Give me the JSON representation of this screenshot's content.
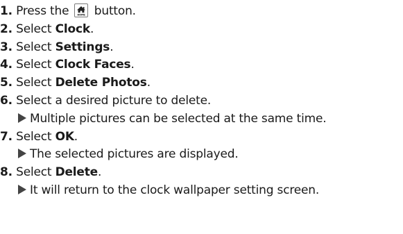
{
  "steps": [
    {
      "num": "1.",
      "before": "Press the",
      "icon": "home-icon",
      "after": "button."
    },
    {
      "num": "2.",
      "prefix": "Select ",
      "bold": "Clock",
      "suffix": "."
    },
    {
      "num": "3.",
      "prefix": "Select ",
      "bold": "Settings",
      "suffix": "."
    },
    {
      "num": "4.",
      "prefix": "Select ",
      "bold": "Clock Faces",
      "suffix": "."
    },
    {
      "num": "5.",
      "prefix": "Select ",
      "bold": "Delete Photos",
      "suffix": "."
    },
    {
      "num": "6.",
      "text": "Select a desired picture to delete."
    },
    {
      "note": "Multiple pictures can be selected at the same time."
    },
    {
      "num": "7.",
      "prefix": "Select ",
      "bold": "OK",
      "suffix": "."
    },
    {
      "note": "The selected pictures are displayed."
    },
    {
      "num": "8.",
      "prefix": "Select ",
      "bold": "Delete",
      "suffix": "."
    },
    {
      "note": "It will return to the clock wallpaper setting screen."
    }
  ],
  "icons": {
    "home_button": "home-icon",
    "note_marker": "triangle-arrow-icon"
  }
}
